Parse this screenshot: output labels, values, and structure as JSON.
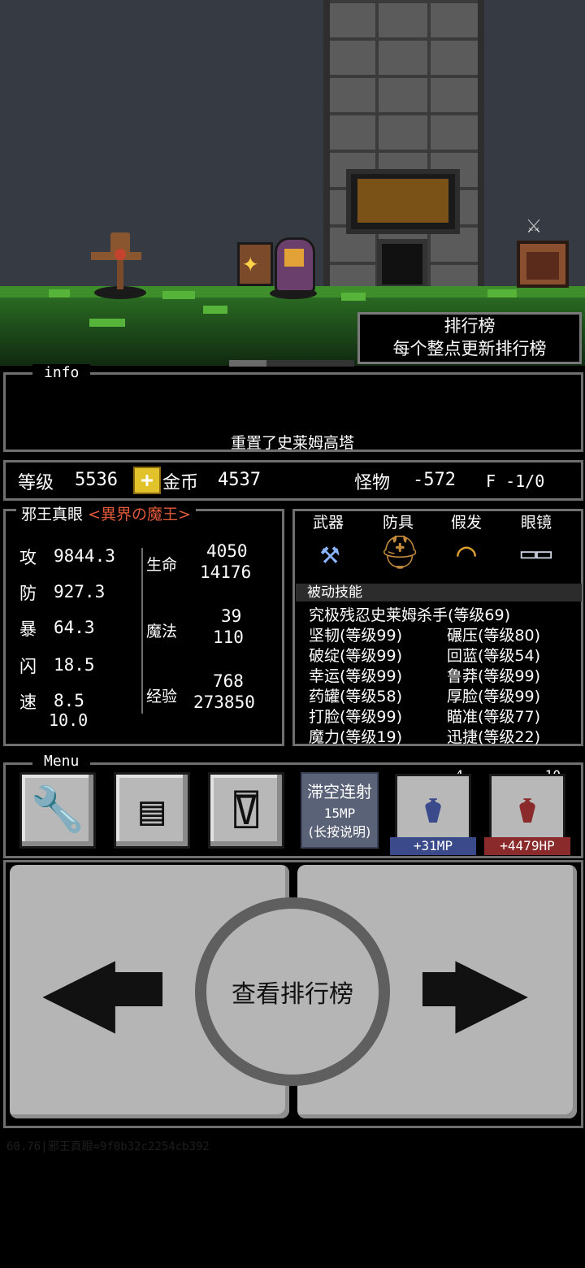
{
  "leaderboard": {
    "title": "排行榜",
    "subtitle": "每个整点更新排行榜"
  },
  "progress": 0.3,
  "info": {
    "legend": "info",
    "message": "重置了史莱姆高塔"
  },
  "stats_bar": {
    "level_label": "等级",
    "level": "5536",
    "coin_label": "金币",
    "coins": "4537",
    "monster_label": "怪物",
    "monster_value": "-572",
    "floor_value": "F -1/0"
  },
  "character": {
    "name": "邪王真眼",
    "title": "<異界の魔王>",
    "attack_label": "攻",
    "attack": "9844.3",
    "defense_label": "防",
    "defense": "927.3",
    "crit_label": "暴",
    "crit": "64.3",
    "dodge_label": "闪",
    "dodge": "18.5",
    "speed_label": "速",
    "speed": "8.5",
    "speed_sub": "10.0",
    "hp_label": "生命",
    "hp": "4050",
    "hp_max": "14176",
    "mp_label": "魔法",
    "mp": "39",
    "mp_max": "110",
    "exp_label": "经验",
    "exp": "768",
    "exp_max": "273850"
  },
  "equipment": {
    "weapon_label": "武器",
    "armor_label": "防具",
    "wig_label": "假发",
    "glasses_label": "眼镜",
    "weapon_icon": "axe-icon",
    "armor_icon": "helmet-icon",
    "wig_icon": "rainbow-wig-icon",
    "glasses_icon": "glasses-icon"
  },
  "passive": {
    "header": "被动技能",
    "top": "究极残忍史莱姆杀手(等级69)",
    "left": [
      "坚韧(等级99)",
      "破绽(等级99)",
      "幸运(等级99)",
      "药罐(等级58)",
      "打脸(等级99)",
      "魔力(等级19)"
    ],
    "right": [
      "碾压(等级80)",
      "回蓝(等级54)",
      "鲁莽(等级99)",
      "厚脸(等级99)",
      "瞄准(等级77)",
      "迅捷(等级22)"
    ]
  },
  "menu": {
    "legend": "Menu",
    "buttons": [
      "wrench-icon",
      "notebook-icon",
      "shop-icon"
    ],
    "skill_name": "滞空连射",
    "skill_cost": "15MP",
    "skill_hint": "(长按说明)",
    "mp_potion_count": "4",
    "mp_potion_label": "+31MP",
    "hp_potion_count": "10",
    "hp_potion_label": "+4479HP"
  },
  "controls": {
    "center_label": "查看排行榜",
    "left_icon": "left-arrow-icon",
    "right_icon": "right-arrow-icon"
  },
  "footer": "60.76|邪王真眼=9f0b32c2254cb392",
  "colors": {
    "accent_red": "#e05a3a",
    "mp_blue": "#3a4a8a",
    "hp_red": "#8a2a2a",
    "grass": "#3f8e2c"
  }
}
